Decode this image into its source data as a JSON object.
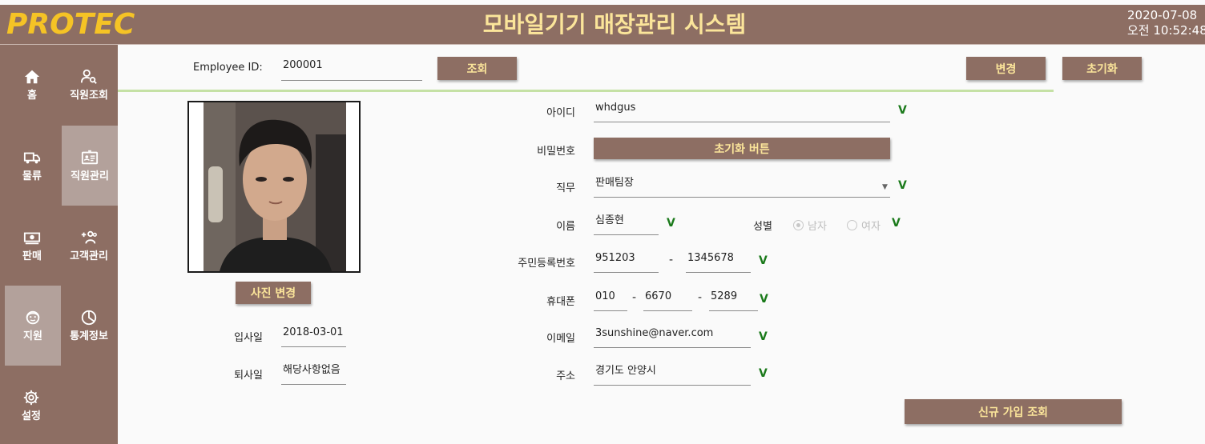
{
  "header": {
    "logo": "PROTEC",
    "title": "모바일기기 매장관리 시스템",
    "date": "2020-07-08",
    "time": "오전 10:52:48"
  },
  "sidebar": {
    "items": [
      {
        "label": "홈",
        "icon": "home-icon"
      },
      {
        "label": "직원조회",
        "icon": "user-search-icon"
      },
      {
        "label": "물류",
        "icon": "truck-icon"
      },
      {
        "label": "직원관리",
        "icon": "id-card-icon"
      },
      {
        "label": "판매",
        "icon": "cash-icon"
      },
      {
        "label": "고객관리",
        "icon": "add-customer-icon"
      },
      {
        "label": "지원",
        "icon": "support-icon"
      },
      {
        "label": "통계정보",
        "icon": "pie-chart-icon"
      },
      {
        "label": "설정",
        "icon": "gear-icon"
      }
    ]
  },
  "search": {
    "employee_id_label": "Employee ID:",
    "employee_id_value": "200001",
    "search_button": "조회",
    "change_button": "변경",
    "reset_button": "초기화"
  },
  "profile": {
    "photo_button": "사진 변경",
    "hire_date_label": "입사일",
    "hire_date_value": "2018-03-01",
    "leave_date_label": "퇴사일",
    "leave_date_value": "해당사항없음"
  },
  "form": {
    "id_label": "아이디",
    "id_value": "whdgus",
    "password_label": "비밀번호",
    "password_reset_button": "초기화 버튼",
    "role_label": "직무",
    "role_value": "판매팀장",
    "name_label": "이름",
    "name_value": "심종현",
    "gender_label": "성별",
    "gender_male": "남자",
    "gender_female": "여자",
    "rrn_label": "주민등록번호",
    "rrn_front": "951203",
    "rrn_dash": "-",
    "rrn_back": "1345678",
    "phone_label": "휴대폰",
    "phone_1": "010",
    "phone_2": "6670",
    "phone_3": "5289",
    "phone_dash": "-",
    "email_label": "이메일",
    "email_value": "3sunshine@naver.com",
    "address_label": "주소",
    "address_value": "경기도 안양시",
    "check_mark": "V",
    "new_signup_button": "신규 가입 조회"
  },
  "colors": {
    "brand": "#8d6e63",
    "accent_text": "#fbe59a",
    "logo": "#f5c325",
    "rule": "#c5e1a5",
    "check": "#1b7a1b"
  }
}
